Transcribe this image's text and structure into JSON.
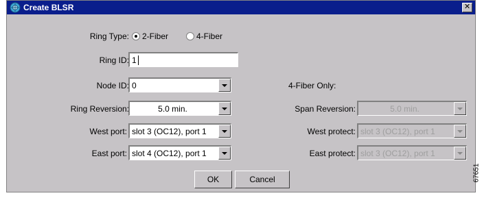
{
  "window": {
    "title": "Create BLSR",
    "close_symbol": "✕"
  },
  "form": {
    "ring_type_label": "Ring Type:",
    "ring_type_options": [
      {
        "label": "2-Fiber",
        "selected": true
      },
      {
        "label": "4-Fiber",
        "selected": false
      }
    ],
    "ring_id_label": "Ring ID:",
    "ring_id_value": "1",
    "node_id_label": "Node ID:",
    "node_id_value": "0",
    "four_fiber_only_label": "4-Fiber Only:",
    "ring_reversion_label": "Ring Reversion:",
    "ring_reversion_value": "5.0 min.",
    "span_reversion_label": "Span Reversion:",
    "span_reversion_value": "5.0 min.",
    "west_port_label": "West port:",
    "west_port_value": "slot  3 (OC12), port 1",
    "west_protect_label": "West protect:",
    "west_protect_value": "slot  3 (OC12), port 1",
    "east_port_label": "East port:",
    "east_port_value": "slot  4 (OC12), port 1",
    "east_protect_label": "East protect:",
    "east_protect_value": "slot  3 (OC12), port 1"
  },
  "buttons": {
    "ok": "OK",
    "cancel": "Cancel"
  },
  "figure_id": "67651"
}
